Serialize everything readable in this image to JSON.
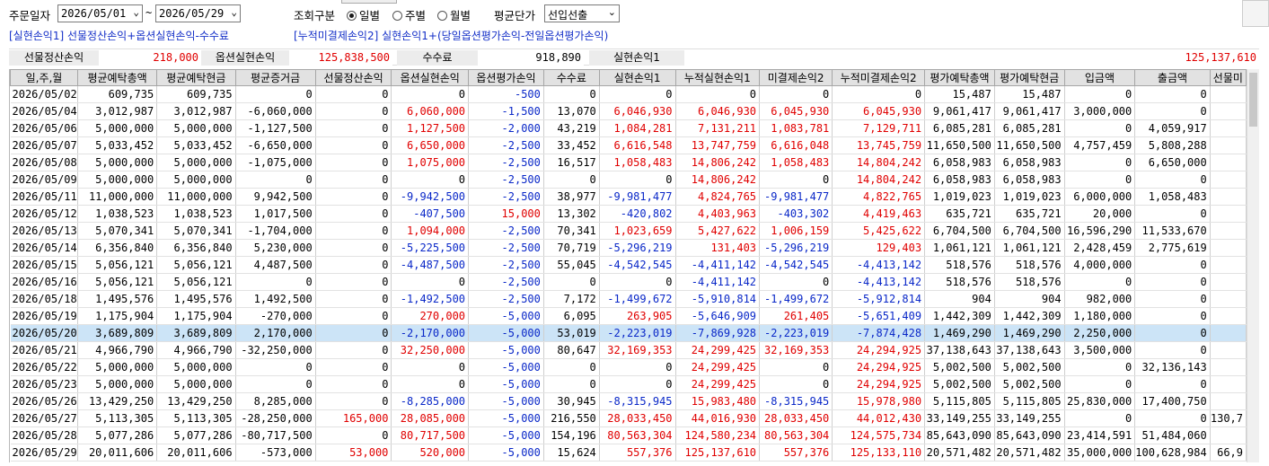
{
  "filter": {
    "order_date_label": "주문일자",
    "date_from": "2026/05/01",
    "date_to": "2026/05/29",
    "tilde": "~",
    "query_type_label": "조회구분",
    "radio_daily": "일별",
    "radio_weekly": "주별",
    "radio_monthly": "월별",
    "selected_query": "일별",
    "avg_unit_label": "평균단가",
    "avg_unit_value": "선입선출"
  },
  "formulas": {
    "f1": "[실현손익1] 선물정산손익+옵션실현손익-수수료",
    "f2": "[누적미결제손익2] 실현손익1+(당일옵션평가손익-전일옵션평가손익)"
  },
  "summary": {
    "futures_settle_label": "선물정산손익",
    "futures_settle_value": "218,000",
    "option_realized_label": "옵션실현손익",
    "option_realized_value": "125,838,500",
    "fee_label": "수수료",
    "fee_value": "918,890",
    "realized1_label": "실현손익1",
    "realized1_value": "125,137,610"
  },
  "colors": {
    "red": "#e00000",
    "blue": "#0a28c8",
    "selected_row": "#cce4f7",
    "formula": "#1530c8"
  },
  "table": {
    "columns": [
      "일,주,월",
      "평균예탁총액",
      "평균예탁현금",
      "평균증거금",
      "선물정산손익",
      "옵션실현손익",
      "옵션평가손익",
      "수수료",
      "실현손익1",
      "누적실현손익1",
      "미결제손익2",
      "누적미결제손익2",
      "평가예탁총액",
      "평가예탁현금",
      "입금액",
      "출금액",
      "선물미"
    ],
    "rows": [
      [
        "2026/05/02",
        "609,735",
        "609,735",
        "0",
        "0",
        "0",
        "-500",
        "0",
        "0",
        "0",
        "0",
        "0",
        "15,487",
        "15,487",
        "0",
        "0",
        ""
      ],
      [
        "2026/05/04",
        "3,012,987",
        "3,012,987",
        "-6,060,000",
        "0",
        "6,060,000",
        "-1,500",
        "13,070",
        "6,046,930",
        "6,046,930",
        "6,045,930",
        "6,045,930",
        "9,061,417",
        "9,061,417",
        "3,000,000",
        "0",
        ""
      ],
      [
        "2026/05/06",
        "5,000,000",
        "5,000,000",
        "-1,127,500",
        "0",
        "1,127,500",
        "-2,000",
        "43,219",
        "1,084,281",
        "7,131,211",
        "1,083,781",
        "7,129,711",
        "6,085,281",
        "6,085,281",
        "0",
        "4,059,917",
        ""
      ],
      [
        "2026/05/07",
        "5,033,452",
        "5,033,452",
        "-6,650,000",
        "0",
        "6,650,000",
        "-2,500",
        "33,452",
        "6,616,548",
        "13,747,759",
        "6,616,048",
        "13,745,759",
        "11,650,500",
        "11,650,500",
        "4,757,459",
        "5,808,288",
        ""
      ],
      [
        "2026/05/08",
        "5,000,000",
        "5,000,000",
        "-1,075,000",
        "0",
        "1,075,000",
        "-2,500",
        "16,517",
        "1,058,483",
        "14,806,242",
        "1,058,483",
        "14,804,242",
        "6,058,983",
        "6,058,983",
        "0",
        "6,650,000",
        ""
      ],
      [
        "2026/05/09",
        "5,000,000",
        "5,000,000",
        "0",
        "0",
        "0",
        "-2,500",
        "0",
        "0",
        "14,806,242",
        "0",
        "14,804,242",
        "6,058,983",
        "6,058,983",
        "0",
        "0",
        ""
      ],
      [
        "2026/05/11",
        "11,000,000",
        "11,000,000",
        "9,942,500",
        "0",
        "-9,942,500",
        "-2,500",
        "38,977",
        "-9,981,477",
        "4,824,765",
        "-9,981,477",
        "4,822,765",
        "1,019,023",
        "1,019,023",
        "6,000,000",
        "1,058,483",
        ""
      ],
      [
        "2026/05/12",
        "1,038,523",
        "1,038,523",
        "1,017,500",
        "0",
        "-407,500",
        "15,000",
        "13,302",
        "-420,802",
        "4,403,963",
        "-403,302",
        "4,419,463",
        "635,721",
        "635,721",
        "20,000",
        "0",
        ""
      ],
      [
        "2026/05/13",
        "5,070,341",
        "5,070,341",
        "-1,704,000",
        "0",
        "1,094,000",
        "-2,500",
        "70,341",
        "1,023,659",
        "5,427,622",
        "1,006,159",
        "5,425,622",
        "6,704,500",
        "6,704,500",
        "16,596,290",
        "11,533,670",
        ""
      ],
      [
        "2026/05/14",
        "6,356,840",
        "6,356,840",
        "5,230,000",
        "0",
        "-5,225,500",
        "-2,500",
        "70,719",
        "-5,296,219",
        "131,403",
        "-5,296,219",
        "129,403",
        "1,061,121",
        "1,061,121",
        "2,428,459",
        "2,775,619",
        ""
      ],
      [
        "2026/05/15",
        "5,056,121",
        "5,056,121",
        "4,487,500",
        "0",
        "-4,487,500",
        "-2,500",
        "55,045",
        "-4,542,545",
        "-4,411,142",
        "-4,542,545",
        "-4,413,142",
        "518,576",
        "518,576",
        "4,000,000",
        "0",
        ""
      ],
      [
        "2026/05/16",
        "5,056,121",
        "5,056,121",
        "0",
        "0",
        "0",
        "-2,500",
        "0",
        "0",
        "-4,411,142",
        "0",
        "-4,413,142",
        "518,576",
        "518,576",
        "0",
        "0",
        ""
      ],
      [
        "2026/05/18",
        "1,495,576",
        "1,495,576",
        "1,492,500",
        "0",
        "-1,492,500",
        "-2,500",
        "7,172",
        "-1,499,672",
        "-5,910,814",
        "-1,499,672",
        "-5,912,814",
        "904",
        "904",
        "982,000",
        "0",
        ""
      ],
      [
        "2026/05/19",
        "1,175,904",
        "1,175,904",
        "-270,000",
        "0",
        "270,000",
        "-5,000",
        "6,095",
        "263,905",
        "-5,646,909",
        "261,405",
        "-5,651,409",
        "1,442,309",
        "1,442,309",
        "1,180,000",
        "0",
        ""
      ],
      [
        "2026/05/20",
        "3,689,809",
        "3,689,809",
        "2,170,000",
        "0",
        "-2,170,000",
        "-5,000",
        "53,019",
        "-2,223,019",
        "-7,869,928",
        "-2,223,019",
        "-7,874,428",
        "1,469,290",
        "1,469,290",
        "2,250,000",
        "0",
        ""
      ],
      [
        "2026/05/21",
        "4,966,790",
        "4,966,790",
        "-32,250,000",
        "0",
        "32,250,000",
        "-5,000",
        "80,647",
        "32,169,353",
        "24,299,425",
        "32,169,353",
        "24,294,925",
        "37,138,643",
        "37,138,643",
        "3,500,000",
        "0",
        ""
      ],
      [
        "2026/05/22",
        "5,000,000",
        "5,000,000",
        "0",
        "0",
        "0",
        "-5,000",
        "0",
        "0",
        "24,299,425",
        "0",
        "24,294,925",
        "5,002,500",
        "5,002,500",
        "0",
        "32,136,143",
        ""
      ],
      [
        "2026/05/23",
        "5,000,000",
        "5,000,000",
        "0",
        "0",
        "0",
        "-5,000",
        "0",
        "0",
        "24,299,425",
        "0",
        "24,294,925",
        "5,002,500",
        "5,002,500",
        "0",
        "0",
        ""
      ],
      [
        "2026/05/26",
        "13,429,250",
        "13,429,250",
        "8,285,000",
        "0",
        "-8,285,000",
        "-5,000",
        "30,945",
        "-8,315,945",
        "15,983,480",
        "-8,315,945",
        "15,978,980",
        "5,115,805",
        "5,115,805",
        "25,830,000",
        "17,400,750",
        ""
      ],
      [
        "2026/05/27",
        "5,113,305",
        "5,113,305",
        "-28,250,000",
        "165,000",
        "28,085,000",
        "-5,000",
        "216,550",
        "28,033,450",
        "44,016,930",
        "28,033,450",
        "44,012,430",
        "33,149,255",
        "33,149,255",
        "0",
        "0",
        "130,7"
      ],
      [
        "2026/05/28",
        "5,077,286",
        "5,077,286",
        "-80,717,500",
        "0",
        "80,717,500",
        "-5,000",
        "154,196",
        "80,563,304",
        "124,580,234",
        "80,563,304",
        "124,575,734",
        "85,643,090",
        "85,643,090",
        "23,414,591",
        "51,484,060",
        ""
      ],
      [
        "2026/05/29",
        "20,011,606",
        "20,011,606",
        "-573,000",
        "53,000",
        "520,000",
        "-5,000",
        "15,624",
        "557,376",
        "125,137,610",
        "557,376",
        "125,133,110",
        "20,571,482",
        "20,571,482",
        "35,000,000",
        "100,628,984",
        "66,9"
      ]
    ]
  }
}
